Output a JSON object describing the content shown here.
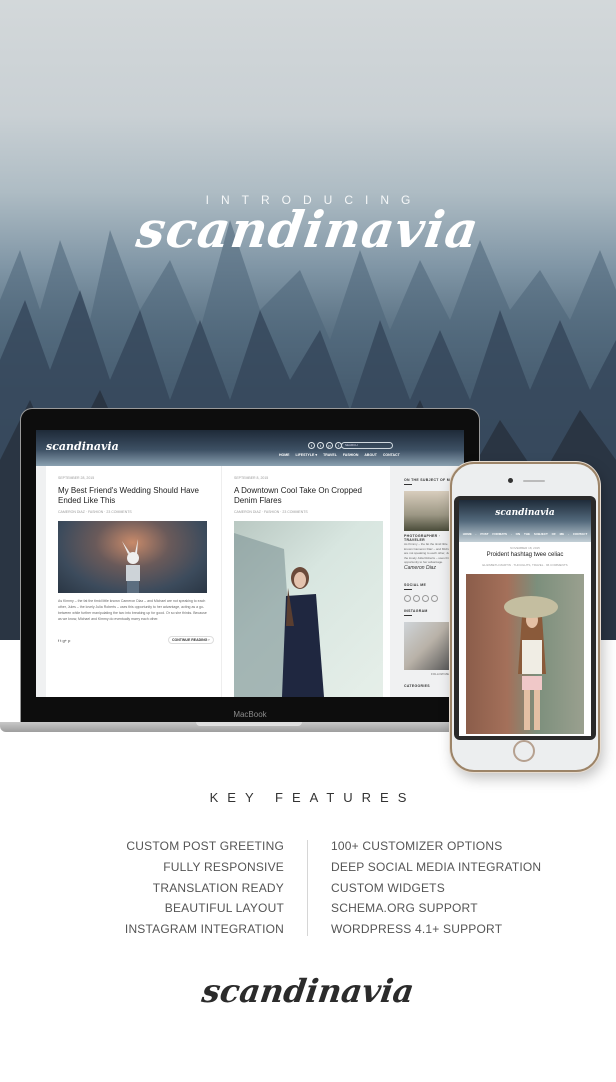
{
  "hero": {
    "intro_label": "INTRODUCING",
    "brand_name": "scandinavia"
  },
  "laptop": {
    "device_label": "MacBook",
    "site": {
      "logo": "scandinavia",
      "social_icons": [
        "facebook-icon",
        "twitter-icon",
        "pinterest-icon",
        "instagram-icon"
      ],
      "social_glyphs": [
        "f",
        "t",
        "p",
        "i"
      ],
      "search_placeholder": "SEARCH",
      "nav": [
        "HOME",
        "LIFESTYLE ▾",
        "TRAVEL",
        "FASHION",
        "ABOUT",
        "CONTACT"
      ],
      "posts": [
        {
          "date": "SEPTEMBER 28, 2015",
          "title": "My Best Friend's Wedding Should Have Ended Like This",
          "meta": "CAMERON DIAZ · FASHION · 23 COMMENTS",
          "excerpt": "As Kimmy – the fat the timid little known Cameron Diaz – and Michael are not speaking to each other, Jules – the lovely Julia Roberts – uses this opportunity to her advantage, acting as a go-between while further manipulating the two into breaking up for good. Or so she thinks. Because as we know, Michael and Kimmy do eventually marry each other.",
          "share_glyphs": "f  t  g+  p",
          "continue_label": "CONTINUE READING ›"
        },
        {
          "date": "SEPTEMBER 8, 2015",
          "title": "A Downtown Cool Take On Cropped Denim Flares",
          "meta": "CAMERON DIAZ · FASHION · 23 COMMENTS"
        }
      ],
      "sidebar": {
        "about_heading": "ON THE SUBJECT OF ME",
        "about_role": "PHOTOGRAPHER · TRAVELER",
        "about_text": "As Kimmy – the fat the timid little known Cameron Diaz – and Michael are not speaking to each other, Jules – the lovely Julia Roberts – uses this opportunity to her advantage.",
        "signature": "Cameron Diaz",
        "social_heading": "SOCIAL ME",
        "instagram_heading": "INSTAGRAM",
        "instagram_follow": "FOLLOW ME",
        "categories_heading": "CATEGORIES"
      }
    }
  },
  "phone": {
    "site": {
      "logo": "scandinavia",
      "nav": "HOME · POST FORMATS · ON THE SUBJECT OF ME · CONTACT",
      "post_date": "NOVEMBER 18, 2015",
      "post_title": "Proident hashtag twee celiac",
      "post_meta": "ELIZABETH MARTIN · THOUGHTS, TRAVEL · 96 COMMENTS"
    }
  },
  "features": {
    "title": "KEY FEATURES",
    "left": [
      "CUSTOM POST GREETING",
      "FULLY RESPONSIVE",
      "TRANSLATION READY",
      "BEAUTIFUL LAYOUT",
      "INSTAGRAM INTEGRATION"
    ],
    "right": [
      "100+ CUSTOMIZER OPTIONS",
      "DEEP SOCIAL MEDIA INTEGRATION",
      "CUSTOM WIDGETS",
      "SCHEMA.ORG SUPPORT",
      "WORDPRESS 4.1+ SUPPORT"
    ]
  },
  "footer": {
    "brand_name": "scandinavia"
  }
}
